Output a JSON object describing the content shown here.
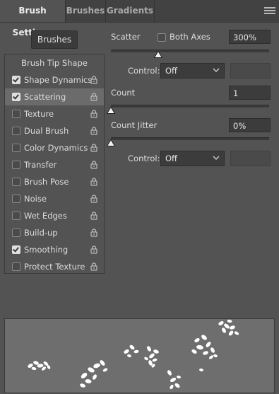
{
  "tabs": [
    {
      "label": "Brush Settings",
      "active": true
    },
    {
      "label": "Brushes",
      "active": false
    },
    {
      "label": "Gradients",
      "active": false
    }
  ],
  "menu_icon": "hamburger-menu-icon",
  "brushes_button": "Brushes",
  "options": {
    "tip_shape": "Brush Tip Shape",
    "items": [
      {
        "label": "Shape Dynamics",
        "checked": true,
        "selected": false
      },
      {
        "label": "Scattering",
        "checked": true,
        "selected": true
      },
      {
        "label": "Texture",
        "checked": false,
        "selected": false
      },
      {
        "label": "Dual Brush",
        "checked": false,
        "selected": false
      },
      {
        "label": "Color Dynamics",
        "checked": false,
        "selected": false
      },
      {
        "label": "Transfer",
        "checked": false,
        "selected": false
      },
      {
        "label": "Brush Pose",
        "checked": false,
        "selected": false
      },
      {
        "label": "Noise",
        "checked": false,
        "selected": false
      },
      {
        "label": "Wet Edges",
        "checked": false,
        "selected": false
      },
      {
        "label": "Build-up",
        "checked": false,
        "selected": false
      },
      {
        "label": "Smoothing",
        "checked": true,
        "selected": false
      },
      {
        "label": "Protect Texture",
        "checked": false,
        "selected": false
      }
    ]
  },
  "scatter": {
    "label": "Scatter",
    "both_axes_label": "Both Axes",
    "both_axes_checked": false,
    "value": "300%",
    "slider_fraction": 0.3,
    "control_label": "Control:",
    "control_value": "Off"
  },
  "count": {
    "label": "Count",
    "value": "1",
    "slider_fraction": 0.0
  },
  "count_jitter": {
    "label": "Count Jitter",
    "value": "0%",
    "slider_fraction": 0.0,
    "control_label": "Control:",
    "control_value": "Off"
  },
  "colors": {
    "panel_bg": "#535353",
    "tab_bar_bg": "#424242",
    "selected_row": "#6b6b6b",
    "preview_bg": "#6e6e6e",
    "stroke_color": "#ffffff"
  }
}
